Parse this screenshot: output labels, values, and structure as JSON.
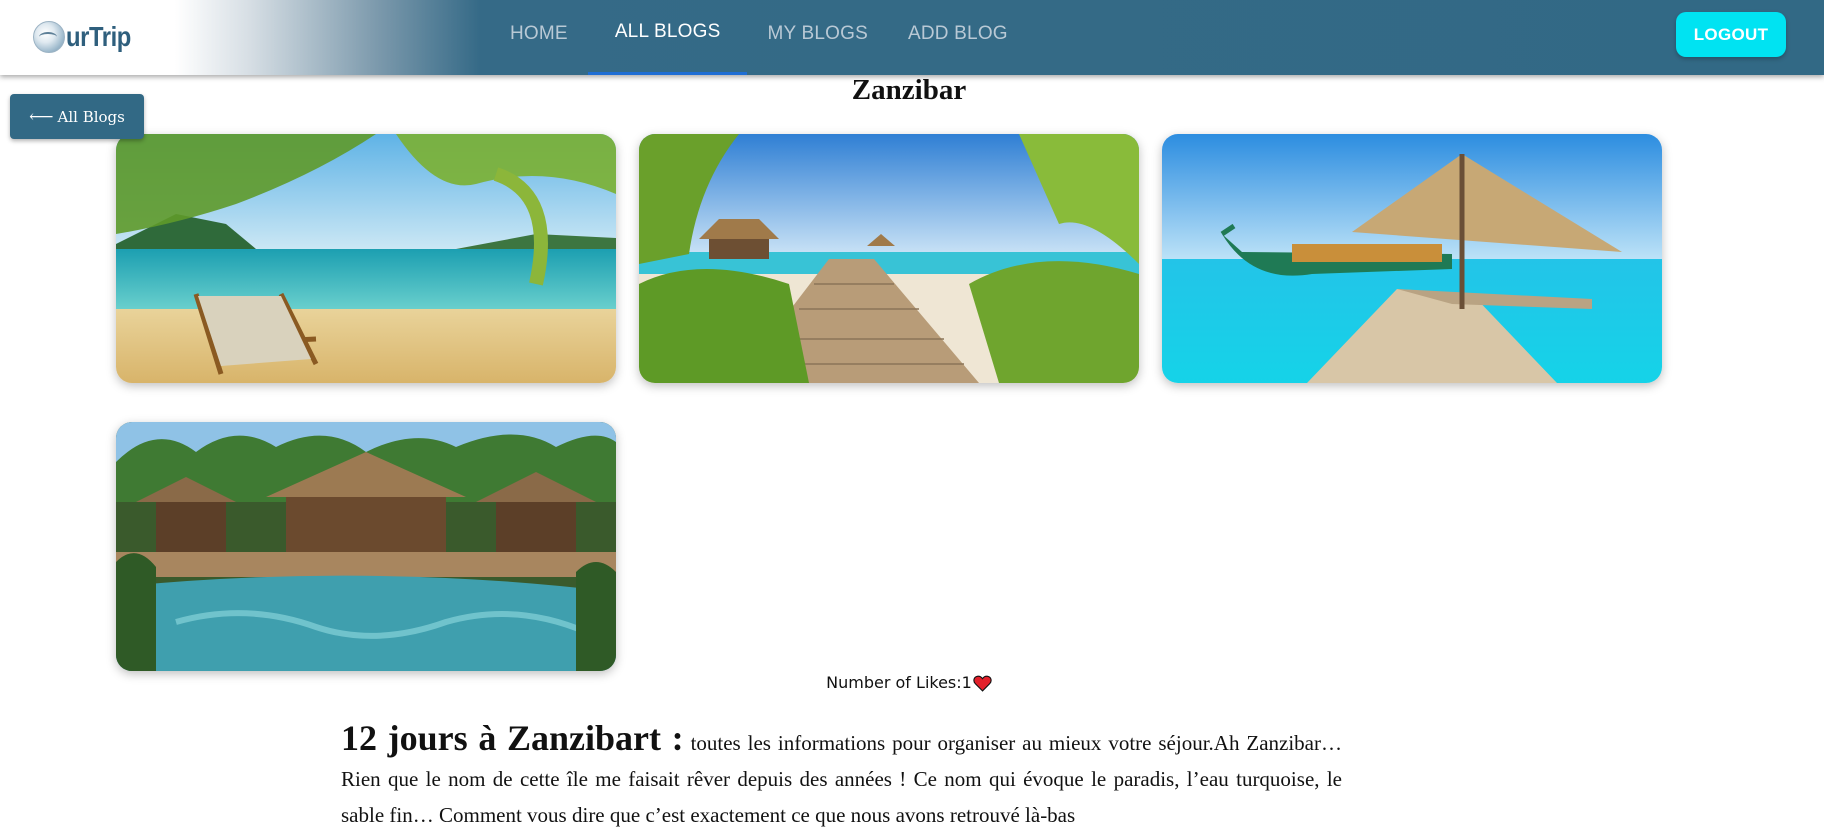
{
  "brand": {
    "name": "urTrip"
  },
  "nav": {
    "links": [
      {
        "label": "HOME"
      },
      {
        "label": "ALL BLOGS",
        "active": true
      },
      {
        "label": "MY BLOGS"
      },
      {
        "label": "ADD BLOG"
      }
    ],
    "logout_label": "LOGOUT"
  },
  "back_button": {
    "label": "All Blogs",
    "icon": "arrow-left-icon"
  },
  "blog": {
    "title": "Zanzibar",
    "images": [
      {
        "alt": "beach with palm leaves and deck chair"
      },
      {
        "alt": "wooden boardwalk to beach huts"
      },
      {
        "alt": "thatched pavilion and boat over turquoise water"
      },
      {
        "alt": "resort pool with thatched villas"
      }
    ],
    "likes_label": "Number of Likes:",
    "likes_count": "1",
    "heading": "12 jours à Zanzibart :",
    "body": "toutes les informations pour organiser au mieux votre séjour.Ah Zanzibar… Rien que le nom de cette île me faisait rêver depuis des années ! Ce nom qui évoque le paradis, l’eau turquoise, le sable fin… Comment vous dire que c’est exactement ce que nous avons retrouvé là-bas"
  },
  "colors": {
    "navbar": "#326985",
    "active_underline": "#1f6ed4",
    "logout_button": "#00e3f2",
    "back_button": "#326985",
    "heart": "#e3202a"
  }
}
